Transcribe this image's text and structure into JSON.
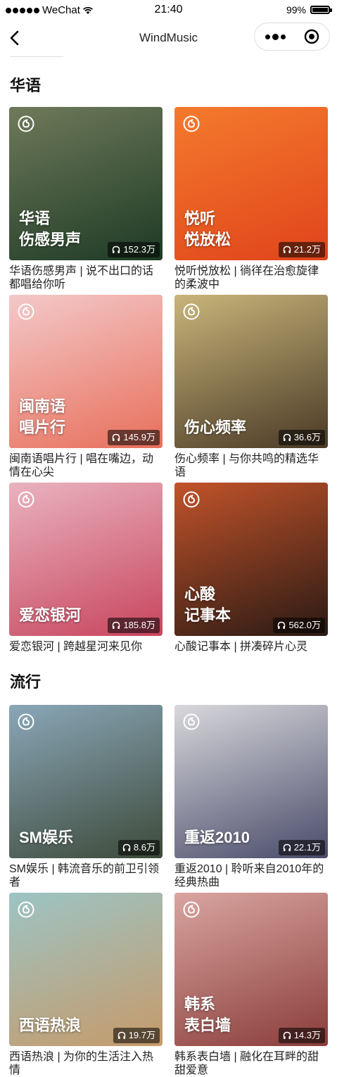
{
  "status_bar": {
    "carrier": "WeChat",
    "time": "21:40",
    "battery": "99%",
    "battery_level": 0.99
  },
  "nav": {
    "title": "WindMusic",
    "back_icon": "chevron-left-icon",
    "more_icon": "more-dots-icon",
    "close_icon": "target-circle-icon"
  },
  "sections": [
    {
      "title": "华语",
      "cards": [
        {
          "cover_label": "华语\n伤感男声",
          "play_count": "152.3万",
          "title": "华语伤感男声 | 说不出口的话都唱给你听",
          "colors": [
            "#6f7a5a",
            "#1d3a25"
          ]
        },
        {
          "cover_label": "悦听\n悦放松",
          "play_count": "21.2万",
          "title": "悦听悦放松 | 徜徉在治愈旋律的柔波中",
          "colors": [
            "#f47a2d",
            "#e0441b"
          ]
        },
        {
          "cover_label": "闽南语\n唱片行",
          "play_count": "145.9万",
          "title": "闽南语唱片行 | 唱在嘴边，动情在心尖",
          "colors": [
            "#f3c9c9",
            "#e86f5b"
          ]
        },
        {
          "cover_label": "伤心频率",
          "play_count": "36.6万",
          "title": "伤心频率 | 与你共鸣的精选华语",
          "colors": [
            "#c9b57a",
            "#4a3a26"
          ]
        },
        {
          "cover_label": "爱恋银河",
          "play_count": "185.8万",
          "title": "爱恋银河 | 跨越星河来见你",
          "colors": [
            "#e9b3bf",
            "#c8455e"
          ]
        },
        {
          "cover_label": "心酸\n记事本",
          "play_count": "562.0万",
          "title": "心酸记事本 | 拼凑碎片心灵",
          "colors": [
            "#c2532a",
            "#2a1a14"
          ]
        }
      ]
    },
    {
      "title": "流行",
      "cards": [
        {
          "cover_label": "SM娱乐",
          "play_count": "8.6万",
          "title": "SM娱乐 | 韩流音乐的前卫引领者",
          "colors": [
            "#8aa7b8",
            "#3d4a3a"
          ]
        },
        {
          "cover_label": "重返2010",
          "play_count": "22.1万",
          "title": "重返2010 | 聆听来自2010年的经典热曲",
          "colors": [
            "#d8d8dc",
            "#4a4b6a"
          ]
        },
        {
          "cover_label": "西语热浪",
          "play_count": "19.7万",
          "title": "西语热浪 | 为你的生活注入热情",
          "colors": [
            "#9cc4c4",
            "#c69a6a"
          ]
        },
        {
          "cover_label": "韩系\n表白墙",
          "play_count": "14.3万",
          "title": "韩系表白墙 | 融化在耳畔的甜甜爱意",
          "colors": [
            "#d9a5a0",
            "#8a3d3a"
          ]
        }
      ]
    }
  ]
}
